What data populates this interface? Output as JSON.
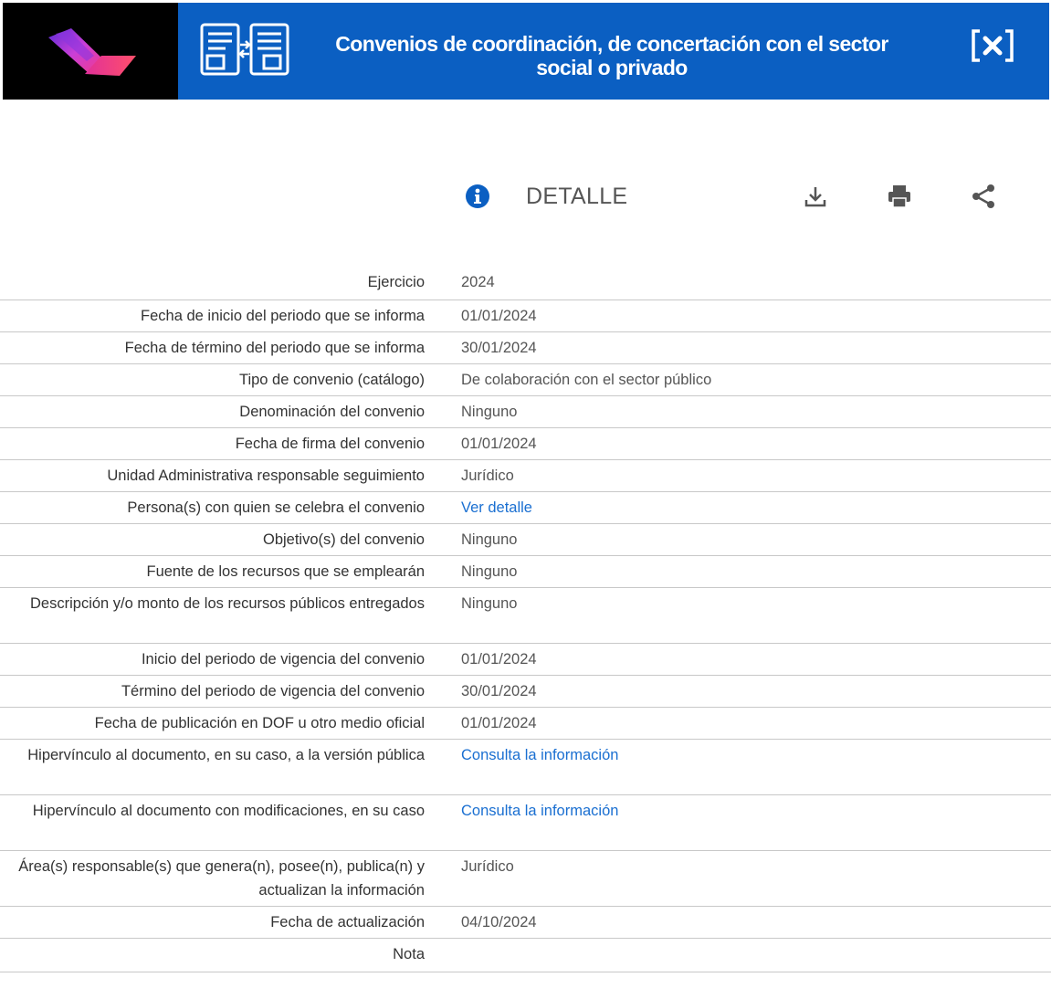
{
  "header": {
    "title_line1": "Convenios de coordinación, de concertación con el sector",
    "title_line2": "social o privado",
    "logo_icon": "brand-logo",
    "title_icon": "agreements-exchange-icon",
    "close_icon": "close-icon"
  },
  "toolbar": {
    "section_label": "DETALLE",
    "icons": [
      "info-icon",
      "download-icon",
      "print-icon",
      "share-icon"
    ]
  },
  "colors": {
    "header_blue": "#0b5fc2",
    "link_blue": "#1a6fd1",
    "logo_background": "#000000"
  },
  "rows": [
    {
      "label": "Ejercicio",
      "value": "2024"
    },
    {
      "label": "Fecha de inicio del periodo que se informa",
      "value": "01/01/2024"
    },
    {
      "label": "Fecha de término del periodo que se informa",
      "value": "30/01/2024"
    },
    {
      "label": "Tipo de convenio (catálogo)",
      "value": "De colaboración con el sector público"
    },
    {
      "label": "Denominación del convenio",
      "value": "Ninguno"
    },
    {
      "label": "Fecha de firma del convenio",
      "value": "01/01/2024"
    },
    {
      "label": "Unidad Administrativa responsable seguimiento",
      "value": "Jurídico"
    },
    {
      "label": "Persona(s) con quien se celebra el convenio",
      "value": "Ver detalle"
    },
    {
      "label": "Objetivo(s) del convenio",
      "value": "Ninguno"
    },
    {
      "label": "Fuente de los recursos que se emplearán",
      "value": "Ninguno"
    },
    {
      "label": "Descripción y/o monto de los recursos públicos entregados",
      "value": "Ninguno"
    },
    {
      "label": "Inicio del periodo de vigencia del convenio",
      "value": "01/01/2024"
    },
    {
      "label": "Término del periodo de vigencia del convenio",
      "value": "30/01/2024"
    },
    {
      "label": "Fecha de publicación en DOF u otro medio oficial",
      "value": "01/01/2024"
    },
    {
      "label": "Hipervínculo al documento, en su caso, a la versión pública",
      "value": "Consulta la información"
    },
    {
      "label": "Hipervínculo al documento con modificaciones, en su caso",
      "value": "Consulta la información"
    },
    {
      "label": "Área(s) responsable(s) que genera(n), posee(n), publica(n) y actualizan la información",
      "value": "Jurídico"
    },
    {
      "label": "Fecha de actualización",
      "value": "04/10/2024"
    },
    {
      "label": "Nota",
      "value": ""
    }
  ]
}
